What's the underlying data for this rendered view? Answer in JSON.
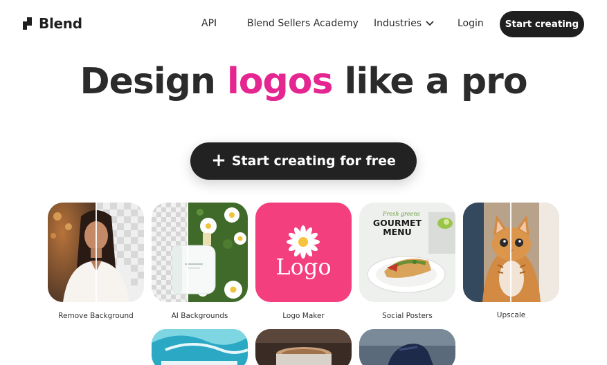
{
  "header": {
    "brand": "Blend",
    "nav": {
      "api": "API",
      "academy": "Blend Sellers Academy",
      "industries": "Industries",
      "login": "Login"
    },
    "start_button": "Start creating"
  },
  "hero": {
    "title_before": "Design ",
    "title_accent": "logos",
    "title_after": " like a pro",
    "cta_label": "Start creating for free"
  },
  "tools": [
    {
      "label": "Remove Background"
    },
    {
      "label": "AI Backgrounds"
    },
    {
      "label": "Logo Maker",
      "image_text": "Logo"
    },
    {
      "label": "Social Posters",
      "image_script": "Fresh greens",
      "image_title": "GOURMET\nMENU"
    },
    {
      "label": "Upscale"
    }
  ],
  "colors": {
    "accent": "#e62690",
    "dark": "#1f1f1f",
    "logo_tile": "#f43f7f"
  }
}
